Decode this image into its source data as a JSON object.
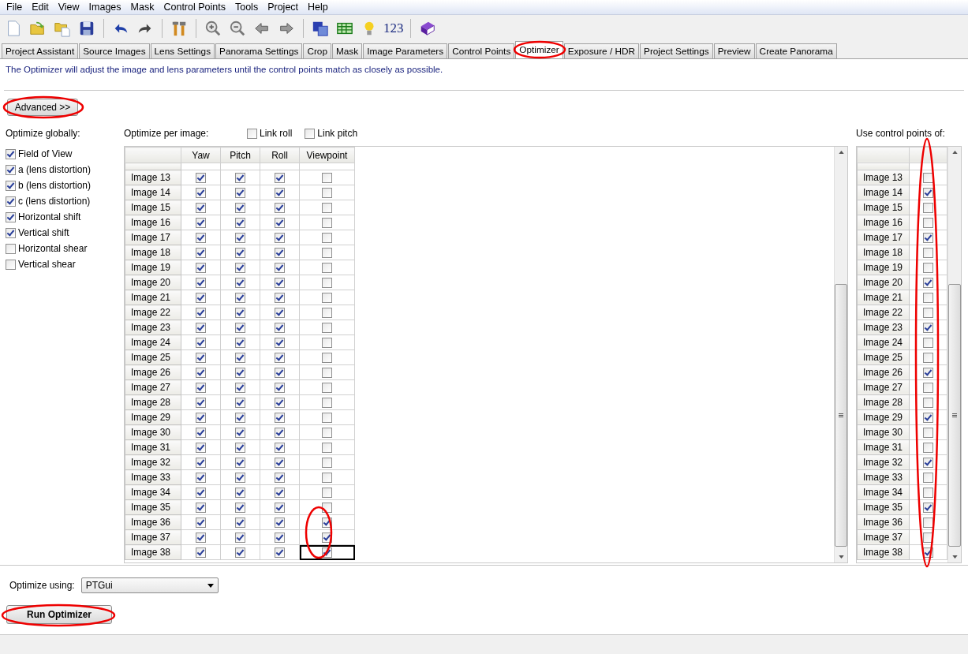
{
  "menu": [
    "File",
    "Edit",
    "View",
    "Images",
    "Mask",
    "Control Points",
    "Tools",
    "Project",
    "Help"
  ],
  "toolbar": [
    {
      "kind": "new"
    },
    {
      "kind": "open"
    },
    {
      "kind": "add"
    },
    {
      "kind": "save"
    },
    {
      "kind": "sep"
    },
    {
      "kind": "undo"
    },
    {
      "kind": "redo"
    },
    {
      "kind": "sep"
    },
    {
      "kind": "tools"
    },
    {
      "kind": "sep"
    },
    {
      "kind": "zoomin"
    },
    {
      "kind": "zoomout"
    },
    {
      "kind": "back"
    },
    {
      "kind": "forward"
    },
    {
      "kind": "sep"
    },
    {
      "kind": "images"
    },
    {
      "kind": "table"
    },
    {
      "kind": "bulb"
    },
    {
      "kind": "text",
      "label": "123"
    },
    {
      "kind": "sep"
    },
    {
      "kind": "book"
    }
  ],
  "tabs": [
    {
      "label": "Project Assistant",
      "selected": false
    },
    {
      "label": "Source Images",
      "selected": false
    },
    {
      "label": "Lens Settings",
      "selected": false
    },
    {
      "label": "Panorama Settings",
      "selected": false
    },
    {
      "label": "Crop",
      "selected": false
    },
    {
      "label": "Mask",
      "selected": false
    },
    {
      "label": "Image Parameters",
      "selected": false
    },
    {
      "label": "Control Points",
      "selected": false
    },
    {
      "label": "Optimizer",
      "selected": true
    },
    {
      "label": "Exposure / HDR",
      "selected": false
    },
    {
      "label": "Project Settings",
      "selected": false
    },
    {
      "label": "Preview",
      "selected": false
    },
    {
      "label": "Create Panorama",
      "selected": false
    }
  ],
  "description": "The Optimizer will adjust the image and lens parameters until the control points match as closely as possible.",
  "advanced_button": "Advanced >>",
  "global": {
    "title": "Optimize globally:",
    "items": [
      {
        "label": "Field of View",
        "checked": true
      },
      {
        "label": "a (lens distortion)",
        "checked": true
      },
      {
        "label": "b (lens distortion)",
        "checked": true
      },
      {
        "label": "c (lens distortion)",
        "checked": true
      },
      {
        "label": "Horizontal shift",
        "checked": true
      },
      {
        "label": "Vertical shift",
        "checked": true
      },
      {
        "label": "Horizontal shear",
        "checked": false
      },
      {
        "label": "Vertical shear",
        "checked": false
      }
    ]
  },
  "per_image": {
    "title": "Optimize per image:",
    "link_roll": {
      "label": "Link roll",
      "checked": false
    },
    "link_pitch": {
      "label": "Link pitch",
      "checked": false
    },
    "columns": [
      "Yaw",
      "Pitch",
      "Roll",
      "Viewpoint"
    ],
    "rows": [
      {
        "name": "Image 13",
        "yaw": true,
        "pitch": true,
        "roll": true,
        "viewpoint": false,
        "selected": false
      },
      {
        "name": "Image 14",
        "yaw": true,
        "pitch": true,
        "roll": true,
        "viewpoint": false,
        "selected": false
      },
      {
        "name": "Image 15",
        "yaw": true,
        "pitch": true,
        "roll": true,
        "viewpoint": false,
        "selected": false
      },
      {
        "name": "Image 16",
        "yaw": true,
        "pitch": true,
        "roll": true,
        "viewpoint": false,
        "selected": false
      },
      {
        "name": "Image 17",
        "yaw": true,
        "pitch": true,
        "roll": true,
        "viewpoint": false,
        "selected": false
      },
      {
        "name": "Image 18",
        "yaw": true,
        "pitch": true,
        "roll": true,
        "viewpoint": false,
        "selected": false
      },
      {
        "name": "Image 19",
        "yaw": true,
        "pitch": true,
        "roll": true,
        "viewpoint": false,
        "selected": false
      },
      {
        "name": "Image 20",
        "yaw": true,
        "pitch": true,
        "roll": true,
        "viewpoint": false,
        "selected": false
      },
      {
        "name": "Image 21",
        "yaw": true,
        "pitch": true,
        "roll": true,
        "viewpoint": false,
        "selected": false
      },
      {
        "name": "Image 22",
        "yaw": true,
        "pitch": true,
        "roll": true,
        "viewpoint": false,
        "selected": false
      },
      {
        "name": "Image 23",
        "yaw": true,
        "pitch": true,
        "roll": true,
        "viewpoint": false,
        "selected": false
      },
      {
        "name": "Image 24",
        "yaw": true,
        "pitch": true,
        "roll": true,
        "viewpoint": false,
        "selected": false
      },
      {
        "name": "Image 25",
        "yaw": true,
        "pitch": true,
        "roll": true,
        "viewpoint": false,
        "selected": false
      },
      {
        "name": "Image 26",
        "yaw": true,
        "pitch": true,
        "roll": true,
        "viewpoint": false,
        "selected": false
      },
      {
        "name": "Image 27",
        "yaw": true,
        "pitch": true,
        "roll": true,
        "viewpoint": false,
        "selected": false
      },
      {
        "name": "Image 28",
        "yaw": true,
        "pitch": true,
        "roll": true,
        "viewpoint": false,
        "selected": false
      },
      {
        "name": "Image 29",
        "yaw": true,
        "pitch": true,
        "roll": true,
        "viewpoint": false,
        "selected": false
      },
      {
        "name": "Image 30",
        "yaw": true,
        "pitch": true,
        "roll": true,
        "viewpoint": false,
        "selected": false
      },
      {
        "name": "Image 31",
        "yaw": true,
        "pitch": true,
        "roll": true,
        "viewpoint": false,
        "selected": false
      },
      {
        "name": "Image 32",
        "yaw": true,
        "pitch": true,
        "roll": true,
        "viewpoint": false,
        "selected": false
      },
      {
        "name": "Image 33",
        "yaw": true,
        "pitch": true,
        "roll": true,
        "viewpoint": false,
        "selected": false
      },
      {
        "name": "Image 34",
        "yaw": true,
        "pitch": true,
        "roll": true,
        "viewpoint": false,
        "selected": false
      },
      {
        "name": "Image 35",
        "yaw": true,
        "pitch": true,
        "roll": true,
        "viewpoint": false,
        "selected": false
      },
      {
        "name": "Image 36",
        "yaw": true,
        "pitch": true,
        "roll": true,
        "viewpoint": true,
        "selected": false
      },
      {
        "name": "Image 37",
        "yaw": true,
        "pitch": true,
        "roll": true,
        "viewpoint": true,
        "selected": false
      },
      {
        "name": "Image 38",
        "yaw": true,
        "pitch": true,
        "roll": true,
        "viewpoint": true,
        "selected": true
      }
    ]
  },
  "control_points": {
    "title": "Use control points of:",
    "rows": [
      {
        "name": "Image 13",
        "checked": false
      },
      {
        "name": "Image 14",
        "checked": true
      },
      {
        "name": "Image 15",
        "checked": false
      },
      {
        "name": "Image 16",
        "checked": false
      },
      {
        "name": "Image 17",
        "checked": true
      },
      {
        "name": "Image 18",
        "checked": false
      },
      {
        "name": "Image 19",
        "checked": false
      },
      {
        "name": "Image 20",
        "checked": true
      },
      {
        "name": "Image 21",
        "checked": false
      },
      {
        "name": "Image 22",
        "checked": false
      },
      {
        "name": "Image 23",
        "checked": true
      },
      {
        "name": "Image 24",
        "checked": false
      },
      {
        "name": "Image 25",
        "checked": false
      },
      {
        "name": "Image 26",
        "checked": true
      },
      {
        "name": "Image 27",
        "checked": false
      },
      {
        "name": "Image 28",
        "checked": false
      },
      {
        "name": "Image 29",
        "checked": true
      },
      {
        "name": "Image 30",
        "checked": false
      },
      {
        "name": "Image 31",
        "checked": false
      },
      {
        "name": "Image 32",
        "checked": true
      },
      {
        "name": "Image 33",
        "checked": false
      },
      {
        "name": "Image 34",
        "checked": false
      },
      {
        "name": "Image 35",
        "checked": true
      },
      {
        "name": "Image 36",
        "checked": false
      },
      {
        "name": "Image 37",
        "checked": false
      },
      {
        "name": "Image 38",
        "checked": true
      }
    ]
  },
  "optimize_using": {
    "label": "Optimize using:",
    "value": "PTGui"
  },
  "run_button": "Run Optimizer"
}
